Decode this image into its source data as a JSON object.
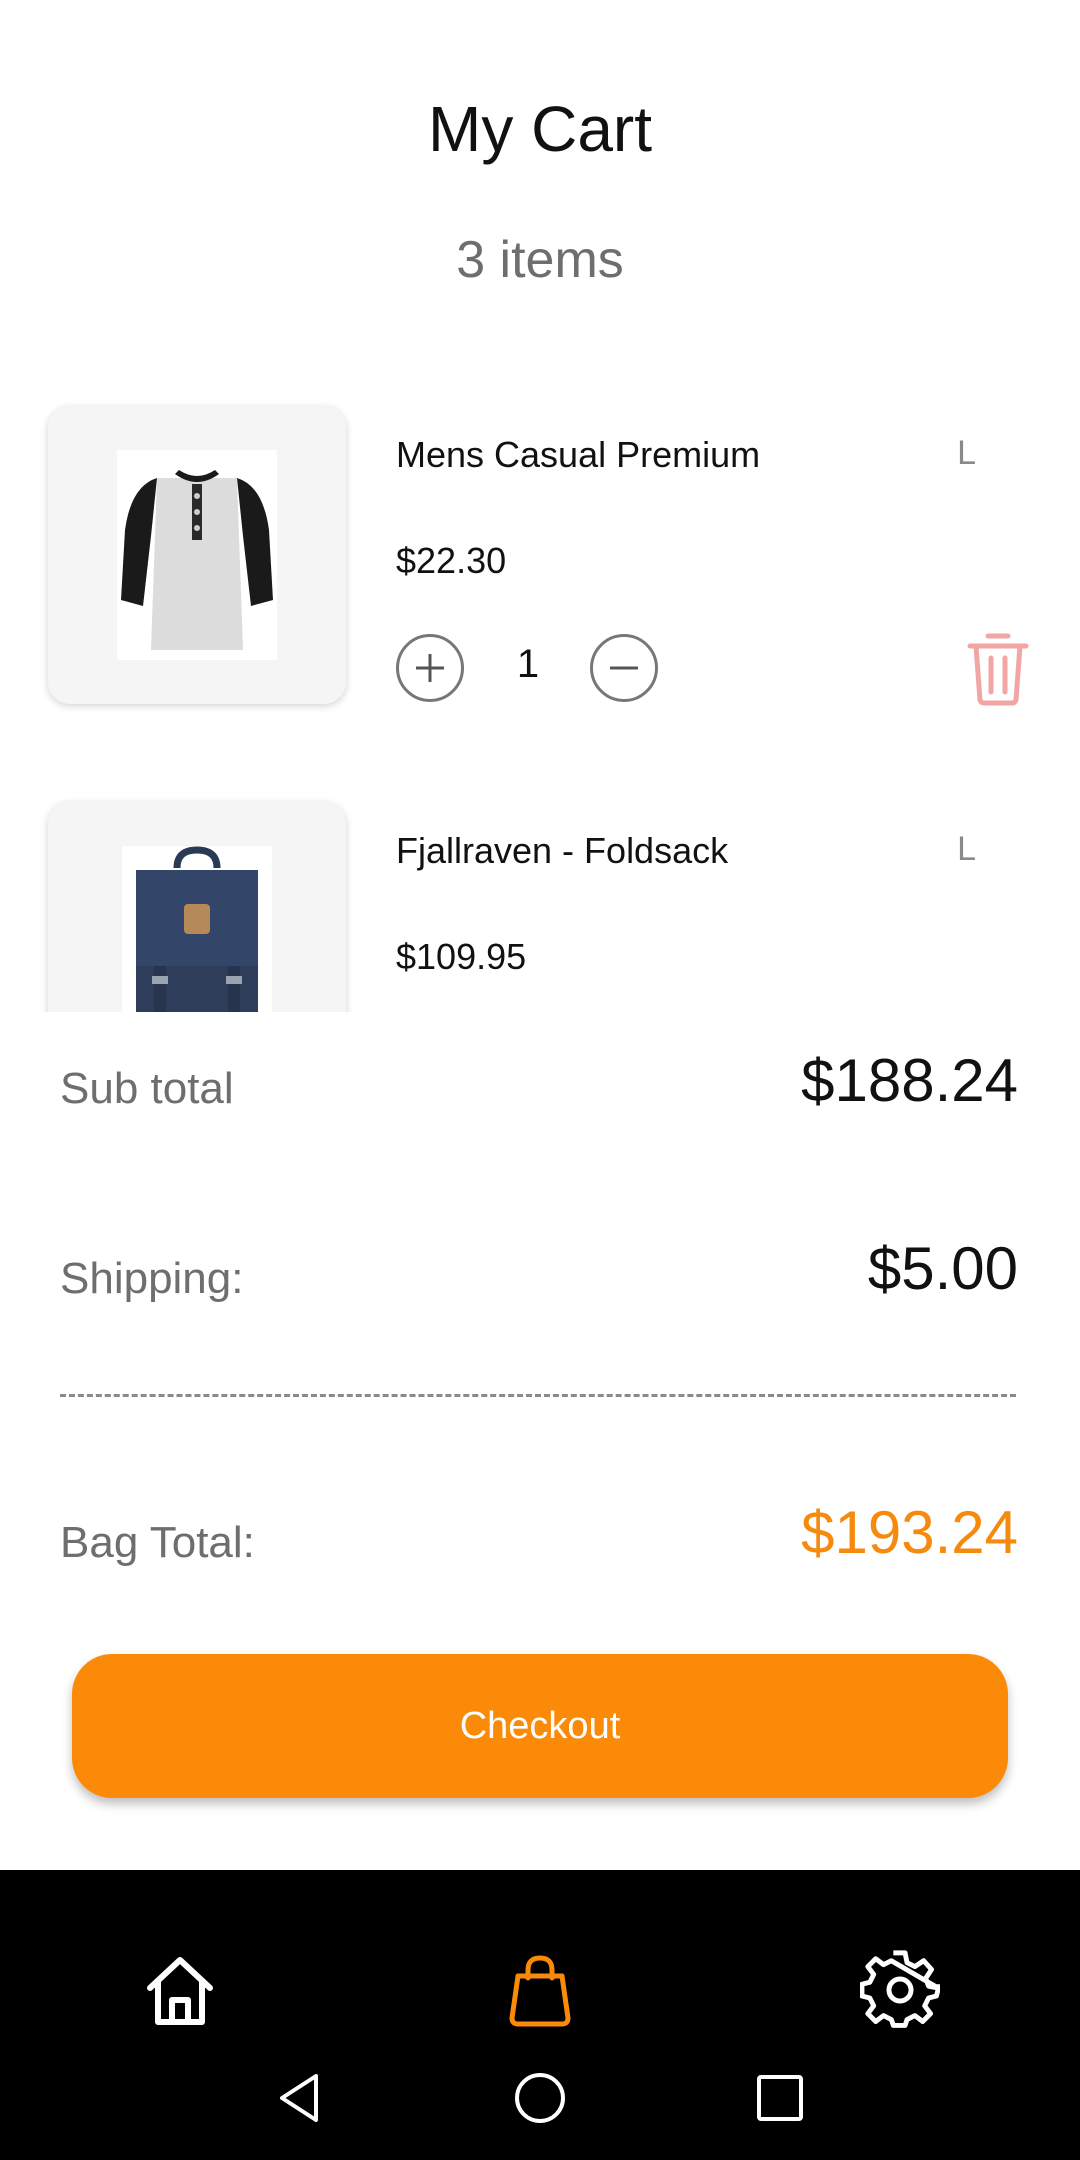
{
  "header": {
    "title": "My Cart",
    "item_count": "3 items"
  },
  "cart": {
    "items": [
      {
        "name": "Mens Casual Premium",
        "size": "L",
        "price": "$22.30",
        "quantity": "1",
        "image_icon": "shirt-image"
      },
      {
        "name": "Fjallraven - Foldsack",
        "size": "L",
        "price": "$109.95",
        "image_icon": "backpack-image"
      }
    ]
  },
  "summary": {
    "subtotal_label": "Sub total",
    "subtotal_value": "$188.24",
    "shipping_label": "Shipping:",
    "shipping_value": "$5.00",
    "total_label": "Bag Total:",
    "total_value": "$193.24"
  },
  "checkout": {
    "label": "Checkout"
  },
  "nav": {
    "items": [
      "home-icon",
      "bag-icon",
      "settings-icon"
    ],
    "active": "bag-icon"
  },
  "colors": {
    "accent": "#fb8a08",
    "total_text": "#f58a0d",
    "delete": "#f2a5a5",
    "nav_bg": "#000000"
  }
}
